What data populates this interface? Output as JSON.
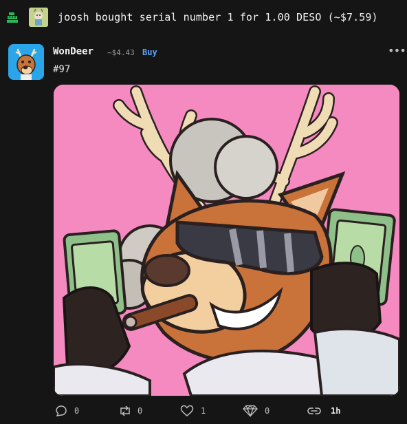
{
  "notification": {
    "text": "joosh bought serial number 1 for 1.00 DESO (~$7.59)",
    "icon": "cash-register-icon"
  },
  "post": {
    "author": "WonDeer",
    "price": "~$4.43",
    "buy_label": "Buy",
    "body": "#97",
    "more_label": "•••"
  },
  "actions": {
    "comments": "0",
    "reposts": "0",
    "likes": "1",
    "diamonds": "0",
    "time": "1h"
  },
  "colors": {
    "background": "#151515",
    "accent": "#5aa6ff",
    "nft_background": "#f58ac0"
  }
}
